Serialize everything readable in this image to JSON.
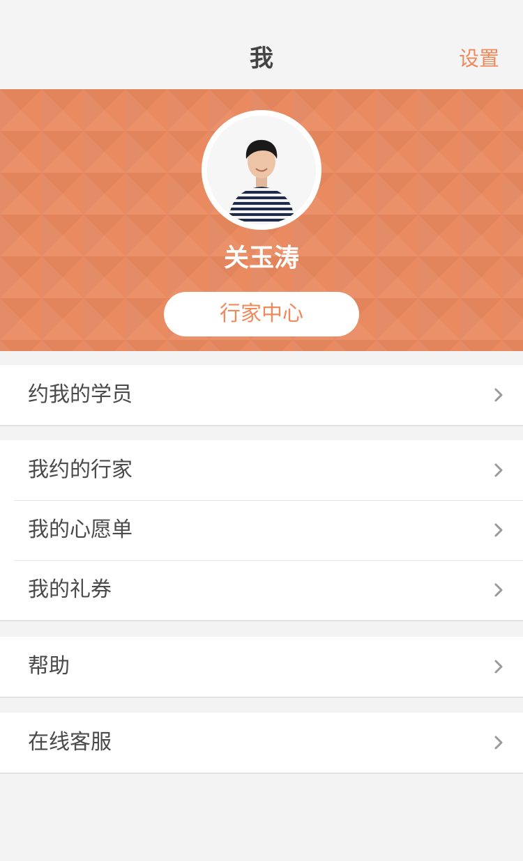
{
  "nav": {
    "title": "我",
    "settings": "设置"
  },
  "profile": {
    "name": "关玉涛",
    "center_button": "行家中心",
    "avatar_icon": "user-avatar-photo"
  },
  "menu": {
    "group1": [
      {
        "label": "约我的学员",
        "icon": "chevron-right-icon"
      }
    ],
    "group2": [
      {
        "label": "我约的行家",
        "icon": "chevron-right-icon"
      },
      {
        "label": "我的心愿单",
        "icon": "chevron-right-icon"
      },
      {
        "label": "我的礼券",
        "icon": "chevron-right-icon"
      }
    ],
    "group3": [
      {
        "label": "帮助",
        "icon": "chevron-right-icon"
      }
    ],
    "group4": [
      {
        "label": "在线客服",
        "icon": "chevron-right-icon"
      }
    ]
  },
  "colors": {
    "accent": "#ef8a5c",
    "header_bg": "#ea8a60",
    "page_bg": "#f3f3f3"
  }
}
